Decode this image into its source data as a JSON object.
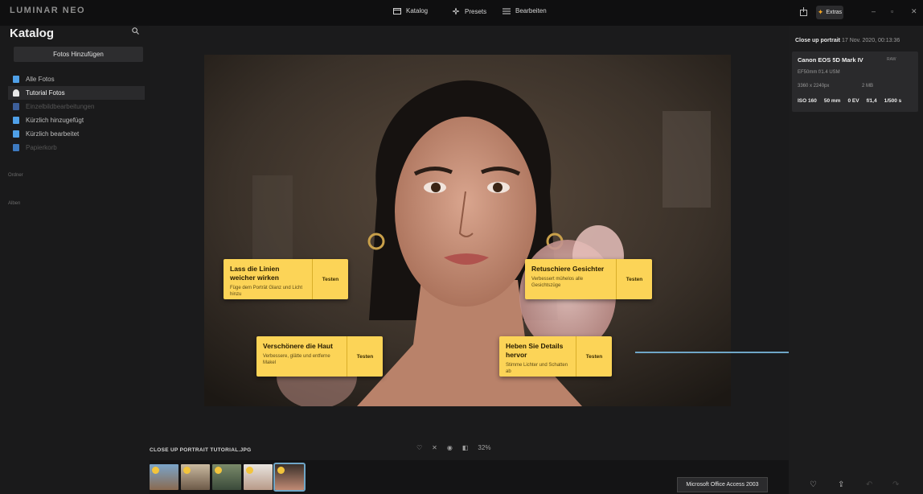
{
  "topbar": {
    "brand": "LUMINAR NEO",
    "nav": [
      {
        "label": "Katalog"
      },
      {
        "label": "Presets"
      },
      {
        "label": "Bearbeiten"
      }
    ],
    "extras_label": "Extras",
    "window_buttons": {
      "minimize": "–",
      "restore": "▫",
      "close": "✕"
    }
  },
  "sidebar": {
    "title": "Katalog",
    "add_button": "Fotos Hinzufügen",
    "items": [
      {
        "label": "Alle Fotos",
        "icon": "photos-icon",
        "color": "#4fa0e8"
      },
      {
        "label": "Tutorial Fotos",
        "icon": "graduation-cap-icon",
        "color": "#e8e8e8"
      },
      {
        "label": "Einzelbildbearbeitungen",
        "icon": "single-edits-icon",
        "color": "#3d5f9a"
      },
      {
        "label": "Kürzlich hinzugefügt",
        "icon": "recently-added-icon",
        "color": "#4fa0e8"
      },
      {
        "label": "Kürzlich bearbeitet",
        "icon": "recently-edited-icon",
        "color": "#4fa0e8"
      },
      {
        "label": "Papierkorb",
        "icon": "trash-icon",
        "color": "#3d7ac0"
      }
    ],
    "section_folders": "Ordner",
    "section_albums": "Alben"
  },
  "callouts": [
    {
      "title": "Lass die Linien weicher wirken",
      "subtitle": "Füge dem Porträt Glanz und Licht hinzu",
      "button": "Testen"
    },
    {
      "title": "Retuschiere Gesichter",
      "subtitle": "Verbessert mühelos alle Gesichtszüge",
      "button": "Testen"
    },
    {
      "title": "Verschönere die Haut",
      "subtitle": "Verbessere, glätte und entferne Makel",
      "button": "Testen"
    },
    {
      "title": "Heben Sie Details hervor",
      "subtitle": "Stimme Lichter und Schatten ab",
      "button": "Testen"
    }
  ],
  "bottom": {
    "filename": "CLOSE UP PORTRAIT TUTORIAL.JPG",
    "zoom": "32%",
    "tooltip": "Microsoft Office Access 2003"
  },
  "info": {
    "title": "Close up portrait",
    "date": "17 Nov. 2020, 00:13:36",
    "camera": "Canon EOS 5D Mark IV",
    "raw_label": "RAW",
    "lens": "EF50mm f/1.4 USM",
    "dimensions": "3360 x 2240px",
    "filesize": "2 MB",
    "exif": [
      "ISO 160",
      "50 mm",
      "0 EV",
      "f/1,4",
      "1/500 s"
    ]
  },
  "colors": {
    "accent": "#fcd457",
    "selection": "#6fa6c7",
    "extras_icon": "#f5a623"
  }
}
